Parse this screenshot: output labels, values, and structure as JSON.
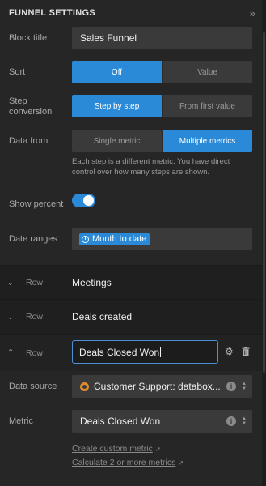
{
  "header": {
    "title": "FUNNEL SETTINGS",
    "collapse_icon": "»"
  },
  "block_title": {
    "label": "Block title",
    "value": "Sales Funnel"
  },
  "sort": {
    "label": "Sort",
    "options": [
      "Off",
      "Value"
    ],
    "selected": "Off"
  },
  "step_conversion": {
    "label": "Step conversion",
    "options": [
      "Step by step",
      "From first value"
    ],
    "selected": "Step by step"
  },
  "data_from": {
    "label": "Data from",
    "options": [
      "Single metric",
      "Multiple metrics"
    ],
    "selected": "Multiple metrics",
    "hint": "Each step is a different metric. You have direct control over how many steps are shown."
  },
  "show_percent": {
    "label": "Show percent",
    "enabled": true
  },
  "date_ranges": {
    "label": "Date ranges",
    "value": "Month to date"
  },
  "rows": [
    {
      "row_label": "Row",
      "name": "Meetings"
    },
    {
      "row_label": "Row",
      "name": "Deals created"
    },
    {
      "row_label": "Row",
      "name": "Deals Closed Won"
    }
  ],
  "data_source": {
    "label": "Data source",
    "value": "Customer Support: databox..."
  },
  "metric": {
    "label": "Metric",
    "value": "Deals Closed Won"
  },
  "links": {
    "create_custom_metric": "Create custom metric",
    "calculate_metrics": "Calculate 2 or more metrics"
  },
  "colors": {
    "accent": "#2b8ad8",
    "background": "#262626",
    "field": "#3a3a3a"
  }
}
